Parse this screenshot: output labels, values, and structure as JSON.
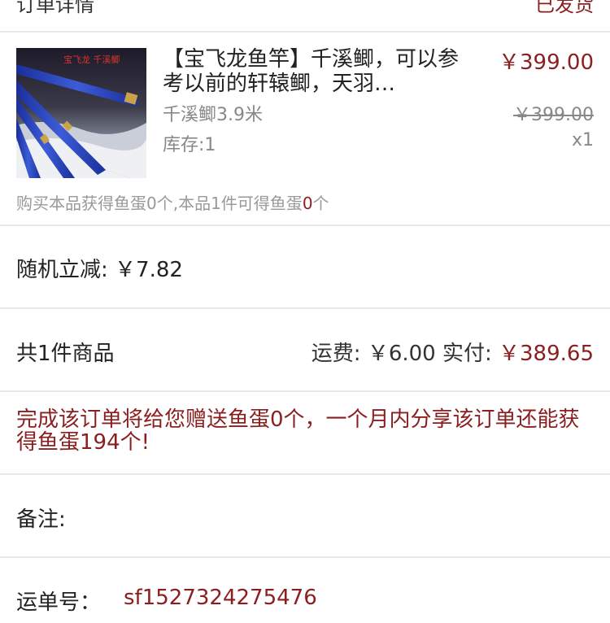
{
  "header": {
    "left_text": "订单详情",
    "right_text": "已发货"
  },
  "product": {
    "image_caption": "宝飞龙 千溪鲫",
    "title": "【宝飞龙鱼竿】千溪鲫，可以参考以前的轩辕鲫，天羽…",
    "price": "￥399.00",
    "variant": "千溪鲫3.9米",
    "original_price": "￥399.00",
    "stock": "库存:1",
    "quantity": "x1",
    "bonus_prefix": "购买本品获得鱼蛋0个,本品1件可得鱼蛋",
    "bonus_count": "0",
    "bonus_suffix": "个"
  },
  "discount": {
    "text": "随机立减: ￥7.82"
  },
  "totals": {
    "count_text": "共1件商品",
    "shipping_text": "运费: ￥6.00 实付: ",
    "paid_amount": "￥389.65"
  },
  "promo": {
    "text": "完成该订单将给您赠送鱼蛋0个，一个月内分享该订单还能获得鱼蛋194个!"
  },
  "remark": {
    "label": "备注:"
  },
  "waybill": {
    "label": "运单号：",
    "number": "sf1527324275476"
  },
  "colors": {
    "accent": "#8b1e1e",
    "muted": "#888888",
    "divider": "#e8e8e8"
  }
}
